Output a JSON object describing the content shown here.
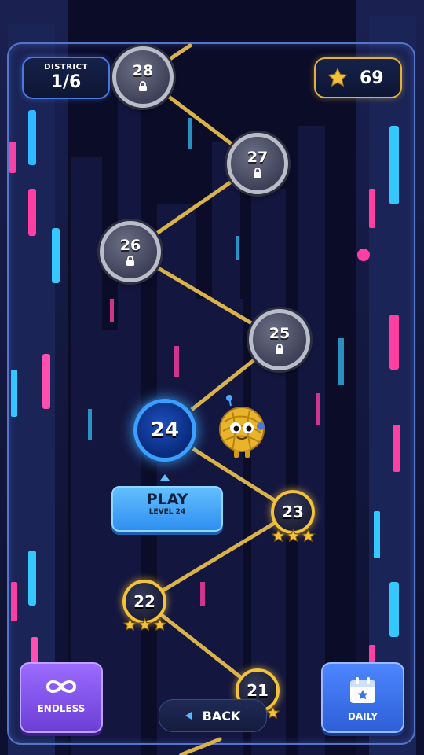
{
  "district": {
    "label": "DISTRICT",
    "value": "1/6"
  },
  "stars": {
    "count": "69",
    "icon": "star-icon",
    "color": "#f2c23a"
  },
  "levels": [
    {
      "num": "28",
      "state": "locked"
    },
    {
      "num": "27",
      "state": "locked"
    },
    {
      "num": "26",
      "state": "locked"
    },
    {
      "num": "25",
      "state": "locked"
    },
    {
      "num": "24",
      "state": "current"
    },
    {
      "num": "23",
      "state": "completed",
      "stars": 3
    },
    {
      "num": "22",
      "state": "completed",
      "stars": 3
    },
    {
      "num": "21",
      "state": "completed",
      "stars": 3
    }
  ],
  "play": {
    "label": "PLAY",
    "sub": "LEVEL 24"
  },
  "buttons": {
    "endless": "ENDLESS",
    "daily": "DAILY",
    "back": "BACK"
  },
  "colors": {
    "path": "#d9b24a",
    "accent": "#3aa0ff",
    "gold": "#f2c23a",
    "endless": "#8a5cf0",
    "daily": "#3d74f0"
  }
}
